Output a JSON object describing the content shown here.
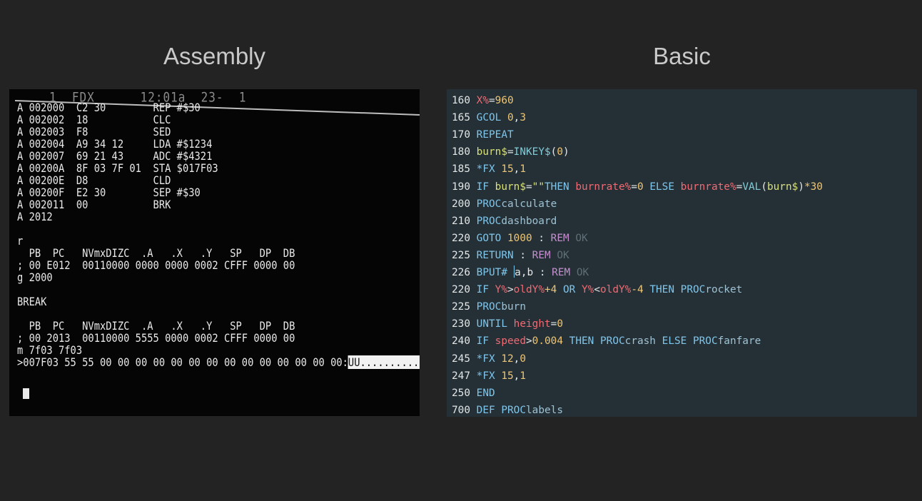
{
  "titles": {
    "assembly": "Assembly",
    "basic": "Basic"
  },
  "assembly": {
    "status": "1  FDX      12:01a  23-  1",
    "lines": [
      "A 002000  C2 30        REP #$30",
      "A 002002  18           CLC",
      "A 002003  F8           SED",
      "A 002004  A9 34 12     LDA #$1234",
      "A 002007  69 21 43     ADC #$4321",
      "A 00200A  8F 03 7F 01  STA $017F03",
      "A 00200E  D8           CLD",
      "A 00200F  E2 30        SEP #$30",
      "A 002011  00           BRK",
      "A 2012",
      "",
      "r",
      "  PB  PC   NVmxDIZC  .A   .X   .Y   SP   DP  DB",
      "; 00 E012  00110000 0000 0000 0002 CFFF 0000 00",
      "g 2000",
      "",
      "BREAK",
      "",
      "  PB  PC   NVmxDIZC  .A   .X   .Y   SP   DP  DB",
      "; 00 2013  00110000 5555 0000 0002 CFFF 0000 00",
      "m 7f03 7f03",
      ">007F03 55 55 00 00 00 00 00 00 00 00 00 00 00 00 00 00:"
    ],
    "dump_ascii": "UU.............."
  },
  "basic": {
    "lines": [
      {
        "n": "160",
        "tokens": [
          {
            "t": "X%",
            "c": "var"
          },
          {
            "t": "=",
            "c": "op"
          },
          {
            "t": "960",
            "c": "num"
          }
        ]
      },
      {
        "n": "165",
        "tokens": [
          {
            "t": "GCOL",
            "c": "kw"
          },
          {
            "t": " ",
            "c": "op"
          },
          {
            "t": "0",
            "c": "num"
          },
          {
            "t": ",",
            "c": "op"
          },
          {
            "t": "3",
            "c": "num"
          }
        ]
      },
      {
        "n": "170",
        "tokens": [
          {
            "t": "REPEAT",
            "c": "kw"
          }
        ]
      },
      {
        "n": "180",
        "tokens": [
          {
            "t": "burn$",
            "c": "str"
          },
          {
            "t": "=",
            "c": "op"
          },
          {
            "t": "INKEY$",
            "c": "fn"
          },
          {
            "t": "(",
            "c": "op"
          },
          {
            "t": "0",
            "c": "num"
          },
          {
            "t": ")",
            "c": "op"
          }
        ]
      },
      {
        "n": "185",
        "tokens": [
          {
            "t": "*FX",
            "c": "kw"
          },
          {
            "t": " ",
            "c": "op"
          },
          {
            "t": "15",
            "c": "num"
          },
          {
            "t": ",",
            "c": "op"
          },
          {
            "t": "1",
            "c": "num"
          }
        ]
      },
      {
        "n": "190",
        "tokens": [
          {
            "t": "IF",
            "c": "kw"
          },
          {
            "t": " ",
            "c": "op"
          },
          {
            "t": "burn$",
            "c": "str"
          },
          {
            "t": "=",
            "c": "op"
          },
          {
            "t": "\"\"",
            "c": "str"
          },
          {
            "t": "THEN",
            "c": "kw"
          },
          {
            "t": " ",
            "c": "op"
          },
          {
            "t": "burnrate%",
            "c": "var"
          },
          {
            "t": "=",
            "c": "op"
          },
          {
            "t": "0",
            "c": "num"
          },
          {
            "t": " ",
            "c": "op"
          },
          {
            "t": "ELSE",
            "c": "kw"
          },
          {
            "t": " ",
            "c": "op"
          },
          {
            "t": "burnrate%",
            "c": "var"
          },
          {
            "t": "=",
            "c": "op"
          },
          {
            "t": "VAL",
            "c": "fn"
          },
          {
            "t": "(",
            "c": "op"
          },
          {
            "t": "burn$",
            "c": "str"
          },
          {
            "t": ")",
            "c": "op"
          },
          {
            "t": "*30",
            "c": "num"
          }
        ]
      },
      {
        "n": "200",
        "tokens": [
          {
            "t": "PROC",
            "c": "proc"
          },
          {
            "t": "calculate",
            "c": "procname"
          }
        ]
      },
      {
        "n": "210",
        "tokens": [
          {
            "t": "PROC",
            "c": "proc"
          },
          {
            "t": "dashboard",
            "c": "procname"
          }
        ]
      },
      {
        "n": "220",
        "tokens": [
          {
            "t": "GOTO",
            "c": "kw"
          },
          {
            "t": " ",
            "c": "op"
          },
          {
            "t": "1000",
            "c": "num"
          },
          {
            "t": " : ",
            "c": "op"
          },
          {
            "t": "REM",
            "c": "rem"
          },
          {
            "t": " OK",
            "c": "comment"
          }
        ]
      },
      {
        "n": "225",
        "tokens": [
          {
            "t": "RETURN",
            "c": "kw"
          },
          {
            "t": " : ",
            "c": "op"
          },
          {
            "t": "REM",
            "c": "rem"
          },
          {
            "t": " OK",
            "c": "comment"
          }
        ]
      },
      {
        "n": "226",
        "tokens": [
          {
            "t": "BPUT#",
            "c": "kw"
          },
          {
            "t": " ",
            "c": "op"
          },
          {
            "t": "|",
            "c": "caret"
          },
          {
            "t": "a,b",
            "c": "op"
          },
          {
            "t": " : ",
            "c": "op"
          },
          {
            "t": "REM",
            "c": "rem"
          },
          {
            "t": " OK",
            "c": "comment"
          }
        ]
      },
      {
        "n": "220",
        "tokens": [
          {
            "t": "IF",
            "c": "kw"
          },
          {
            "t": " ",
            "c": "op"
          },
          {
            "t": "Y%",
            "c": "var"
          },
          {
            "t": ">",
            "c": "op"
          },
          {
            "t": "oldY%",
            "c": "var"
          },
          {
            "t": "+4",
            "c": "num"
          },
          {
            "t": " ",
            "c": "op"
          },
          {
            "t": "OR",
            "c": "kw"
          },
          {
            "t": " ",
            "c": "op"
          },
          {
            "t": "Y%",
            "c": "var"
          },
          {
            "t": "<",
            "c": "op"
          },
          {
            "t": "oldY%",
            "c": "var"
          },
          {
            "t": "-4",
            "c": "num"
          },
          {
            "t": " ",
            "c": "op"
          },
          {
            "t": "THEN",
            "c": "kw"
          },
          {
            "t": " ",
            "c": "op"
          },
          {
            "t": "PROC",
            "c": "proc"
          },
          {
            "t": "rocket",
            "c": "procname"
          }
        ]
      },
      {
        "n": "225",
        "tokens": [
          {
            "t": "PROC",
            "c": "proc"
          },
          {
            "t": "burn",
            "c": "procname"
          }
        ]
      },
      {
        "n": "230",
        "tokens": [
          {
            "t": "UNTIL",
            "c": "kw"
          },
          {
            "t": " ",
            "c": "op"
          },
          {
            "t": "height",
            "c": "var"
          },
          {
            "t": "=",
            "c": "op"
          },
          {
            "t": "0",
            "c": "num"
          }
        ]
      },
      {
        "n": "240",
        "tokens": [
          {
            "t": "IF",
            "c": "kw"
          },
          {
            "t": " ",
            "c": "op"
          },
          {
            "t": "speed",
            "c": "var"
          },
          {
            "t": ">",
            "c": "op"
          },
          {
            "t": "0.004",
            "c": "num"
          },
          {
            "t": " ",
            "c": "op"
          },
          {
            "t": "THEN",
            "c": "kw"
          },
          {
            "t": " ",
            "c": "op"
          },
          {
            "t": "PROC",
            "c": "proc"
          },
          {
            "t": "crash",
            "c": "procname"
          },
          {
            "t": " ",
            "c": "op"
          },
          {
            "t": "ELSE",
            "c": "kw"
          },
          {
            "t": " ",
            "c": "op"
          },
          {
            "t": "PROC",
            "c": "proc"
          },
          {
            "t": "fanfare",
            "c": "procname"
          }
        ]
      },
      {
        "n": "245",
        "tokens": [
          {
            "t": "*FX",
            "c": "kw"
          },
          {
            "t": " ",
            "c": "op"
          },
          {
            "t": "12",
            "c": "num"
          },
          {
            "t": ",",
            "c": "op"
          },
          {
            "t": "0",
            "c": "num"
          }
        ]
      },
      {
        "n": "247",
        "tokens": [
          {
            "t": "*FX",
            "c": "kw"
          },
          {
            "t": " ",
            "c": "op"
          },
          {
            "t": "15",
            "c": "num"
          },
          {
            "t": ",",
            "c": "op"
          },
          {
            "t": "1",
            "c": "num"
          }
        ]
      },
      {
        "n": "250",
        "tokens": [
          {
            "t": "END",
            "c": "kw"
          }
        ]
      },
      {
        "n": "700",
        "tokens": [
          {
            "t": "DEF",
            "c": "kw"
          },
          {
            "t": " ",
            "c": "op"
          },
          {
            "t": "PROC",
            "c": "proc"
          },
          {
            "t": "labels",
            "c": "procname"
          }
        ]
      }
    ]
  },
  "colors": {
    "background": "#232323",
    "crt_background": "#050505",
    "crt_text": "#e9e9e9",
    "editor_background": "#243036"
  }
}
